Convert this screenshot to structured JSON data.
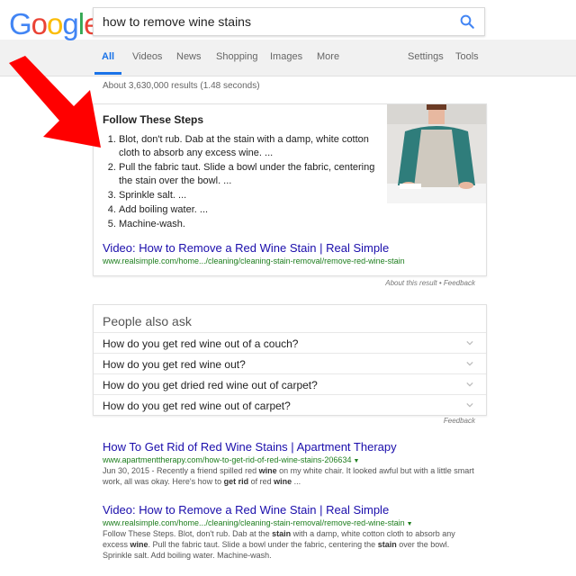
{
  "logo": {
    "letters": [
      "G",
      "o",
      "o",
      "g",
      "l",
      "e"
    ],
    "colors": [
      "#4285F4",
      "#EA4335",
      "#FBBC05",
      "#4285F4",
      "#34A853",
      "#EA4335"
    ]
  },
  "search": {
    "query": "how to remove wine stains"
  },
  "tabs": [
    {
      "label": "All",
      "active": true
    },
    {
      "label": "Videos"
    },
    {
      "label": "News"
    },
    {
      "label": "Shopping"
    },
    {
      "label": "Images"
    },
    {
      "label": "More"
    },
    {
      "label": "Settings"
    },
    {
      "label": "Tools"
    }
  ],
  "stats": "About 3,630,000 results (1.48 seconds)",
  "snippet": {
    "title": "Follow These Steps",
    "steps": [
      "Blot, don't rub. Dab at the stain with a damp, white cotton cloth to absorb any excess wine. ...",
      "Pull the fabric taut. Slide a bowl under the fabric, centering the stain over the bowl. ...",
      "Sprinkle salt. ...",
      "Add boiling water. ...",
      "Machine-wash."
    ],
    "link": "Video: How to Remove a Red Wine Stain | Real Simple",
    "url": "www.realsimple.com/home.../cleaning/cleaning-stain-removal/remove-red-wine-stain",
    "about": "About this result • Feedback"
  },
  "paa": {
    "title": "People also ask",
    "questions": [
      "How do you get red wine out of a couch?",
      "How do you get red wine out?",
      "How do you get dried red wine out of carpet?",
      "How do you get red wine out of carpet?"
    ],
    "feedback": "Feedback"
  },
  "results": [
    {
      "title": "How To Get Rid of Red Wine Stains | Apartment Therapy",
      "url": "www.apartmenttherapy.com/how-to-get-rid-of-red-wine-stains-206634",
      "date": "Jun 30, 2015",
      "snippet_parts": [
        {
          "t": " - Recently a friend spilled red ",
          "b": false
        },
        {
          "t": "wine",
          "b": true
        },
        {
          "t": " on my white chair. It looked awful but with a little smart work, all was okay. Here's how to ",
          "b": false
        },
        {
          "t": "get rid",
          "b": true
        },
        {
          "t": " of red ",
          "b": false
        },
        {
          "t": "wine",
          "b": true
        },
        {
          "t": " ...",
          "b": false
        }
      ]
    },
    {
      "title": "Video: How to Remove a Red Wine Stain | Real Simple",
      "url": "www.realsimple.com/home.../cleaning/cleaning-stain-removal/remove-red-wine-stain",
      "date": "",
      "snippet_parts": [
        {
          "t": "Follow These Steps. Blot, don't rub. Dab at the ",
          "b": false
        },
        {
          "t": "stain",
          "b": true
        },
        {
          "t": " with a damp, white cotton cloth to absorb any excess ",
          "b": false
        },
        {
          "t": "wine",
          "b": true
        },
        {
          "t": ". Pull the fabric taut. Slide a bowl under the fabric, centering the ",
          "b": false
        },
        {
          "t": "stain",
          "b": true
        },
        {
          "t": " over the bowl. Sprinkle salt. Add boiling water. Machine-wash.",
          "b": false
        }
      ]
    }
  ],
  "colors": {
    "link": "#1a0dab",
    "url": "#1e7e1e",
    "accent": "#1a73e8",
    "arrow": "#ff0000"
  }
}
